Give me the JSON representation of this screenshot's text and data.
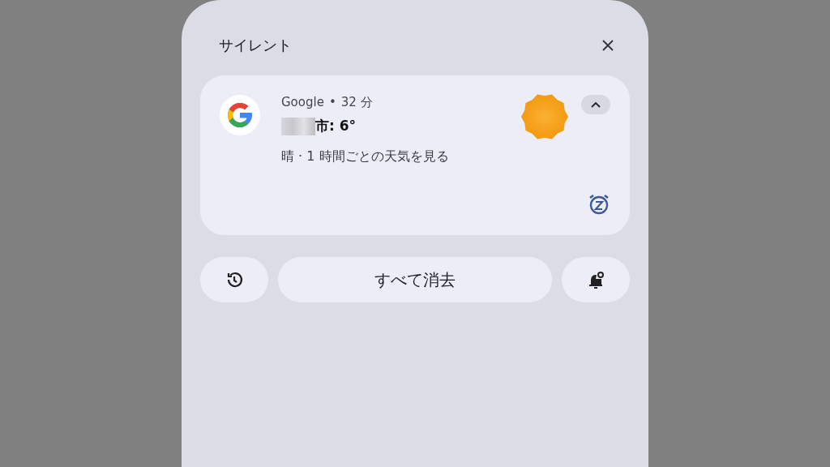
{
  "section": {
    "title": "サイレント"
  },
  "notification": {
    "app": "Google",
    "separator": "•",
    "time": "32 分",
    "title": "市: 6°",
    "body": "晴 · 1 時間ごとの天気を見る",
    "expanded": true
  },
  "actions": {
    "clear_all": "すべて消去"
  }
}
